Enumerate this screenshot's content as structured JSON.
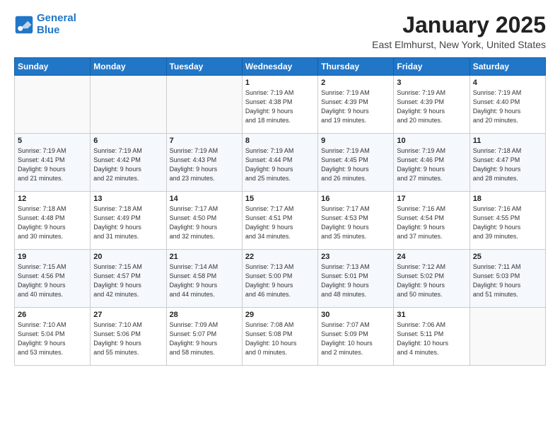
{
  "header": {
    "logo_line1": "General",
    "logo_line2": "Blue",
    "month": "January 2025",
    "location": "East Elmhurst, New York, United States"
  },
  "weekdays": [
    "Sunday",
    "Monday",
    "Tuesday",
    "Wednesday",
    "Thursday",
    "Friday",
    "Saturday"
  ],
  "weeks": [
    [
      {
        "day": "",
        "content": ""
      },
      {
        "day": "",
        "content": ""
      },
      {
        "day": "",
        "content": ""
      },
      {
        "day": "1",
        "content": "Sunrise: 7:19 AM\nSunset: 4:38 PM\nDaylight: 9 hours\nand 18 minutes."
      },
      {
        "day": "2",
        "content": "Sunrise: 7:19 AM\nSunset: 4:39 PM\nDaylight: 9 hours\nand 19 minutes."
      },
      {
        "day": "3",
        "content": "Sunrise: 7:19 AM\nSunset: 4:39 PM\nDaylight: 9 hours\nand 20 minutes."
      },
      {
        "day": "4",
        "content": "Sunrise: 7:19 AM\nSunset: 4:40 PM\nDaylight: 9 hours\nand 20 minutes."
      }
    ],
    [
      {
        "day": "5",
        "content": "Sunrise: 7:19 AM\nSunset: 4:41 PM\nDaylight: 9 hours\nand 21 minutes."
      },
      {
        "day": "6",
        "content": "Sunrise: 7:19 AM\nSunset: 4:42 PM\nDaylight: 9 hours\nand 22 minutes."
      },
      {
        "day": "7",
        "content": "Sunrise: 7:19 AM\nSunset: 4:43 PM\nDaylight: 9 hours\nand 23 minutes."
      },
      {
        "day": "8",
        "content": "Sunrise: 7:19 AM\nSunset: 4:44 PM\nDaylight: 9 hours\nand 25 minutes."
      },
      {
        "day": "9",
        "content": "Sunrise: 7:19 AM\nSunset: 4:45 PM\nDaylight: 9 hours\nand 26 minutes."
      },
      {
        "day": "10",
        "content": "Sunrise: 7:19 AM\nSunset: 4:46 PM\nDaylight: 9 hours\nand 27 minutes."
      },
      {
        "day": "11",
        "content": "Sunrise: 7:18 AM\nSunset: 4:47 PM\nDaylight: 9 hours\nand 28 minutes."
      }
    ],
    [
      {
        "day": "12",
        "content": "Sunrise: 7:18 AM\nSunset: 4:48 PM\nDaylight: 9 hours\nand 30 minutes."
      },
      {
        "day": "13",
        "content": "Sunrise: 7:18 AM\nSunset: 4:49 PM\nDaylight: 9 hours\nand 31 minutes."
      },
      {
        "day": "14",
        "content": "Sunrise: 7:17 AM\nSunset: 4:50 PM\nDaylight: 9 hours\nand 32 minutes."
      },
      {
        "day": "15",
        "content": "Sunrise: 7:17 AM\nSunset: 4:51 PM\nDaylight: 9 hours\nand 34 minutes."
      },
      {
        "day": "16",
        "content": "Sunrise: 7:17 AM\nSunset: 4:53 PM\nDaylight: 9 hours\nand 35 minutes."
      },
      {
        "day": "17",
        "content": "Sunrise: 7:16 AM\nSunset: 4:54 PM\nDaylight: 9 hours\nand 37 minutes."
      },
      {
        "day": "18",
        "content": "Sunrise: 7:16 AM\nSunset: 4:55 PM\nDaylight: 9 hours\nand 39 minutes."
      }
    ],
    [
      {
        "day": "19",
        "content": "Sunrise: 7:15 AM\nSunset: 4:56 PM\nDaylight: 9 hours\nand 40 minutes."
      },
      {
        "day": "20",
        "content": "Sunrise: 7:15 AM\nSunset: 4:57 PM\nDaylight: 9 hours\nand 42 minutes."
      },
      {
        "day": "21",
        "content": "Sunrise: 7:14 AM\nSunset: 4:58 PM\nDaylight: 9 hours\nand 44 minutes."
      },
      {
        "day": "22",
        "content": "Sunrise: 7:13 AM\nSunset: 5:00 PM\nDaylight: 9 hours\nand 46 minutes."
      },
      {
        "day": "23",
        "content": "Sunrise: 7:13 AM\nSunset: 5:01 PM\nDaylight: 9 hours\nand 48 minutes."
      },
      {
        "day": "24",
        "content": "Sunrise: 7:12 AM\nSunset: 5:02 PM\nDaylight: 9 hours\nand 50 minutes."
      },
      {
        "day": "25",
        "content": "Sunrise: 7:11 AM\nSunset: 5:03 PM\nDaylight: 9 hours\nand 51 minutes."
      }
    ],
    [
      {
        "day": "26",
        "content": "Sunrise: 7:10 AM\nSunset: 5:04 PM\nDaylight: 9 hours\nand 53 minutes."
      },
      {
        "day": "27",
        "content": "Sunrise: 7:10 AM\nSunset: 5:06 PM\nDaylight: 9 hours\nand 55 minutes."
      },
      {
        "day": "28",
        "content": "Sunrise: 7:09 AM\nSunset: 5:07 PM\nDaylight: 9 hours\nand 58 minutes."
      },
      {
        "day": "29",
        "content": "Sunrise: 7:08 AM\nSunset: 5:08 PM\nDaylight: 10 hours\nand 0 minutes."
      },
      {
        "day": "30",
        "content": "Sunrise: 7:07 AM\nSunset: 5:09 PM\nDaylight: 10 hours\nand 2 minutes."
      },
      {
        "day": "31",
        "content": "Sunrise: 7:06 AM\nSunset: 5:11 PM\nDaylight: 10 hours\nand 4 minutes."
      },
      {
        "day": "",
        "content": ""
      }
    ]
  ]
}
